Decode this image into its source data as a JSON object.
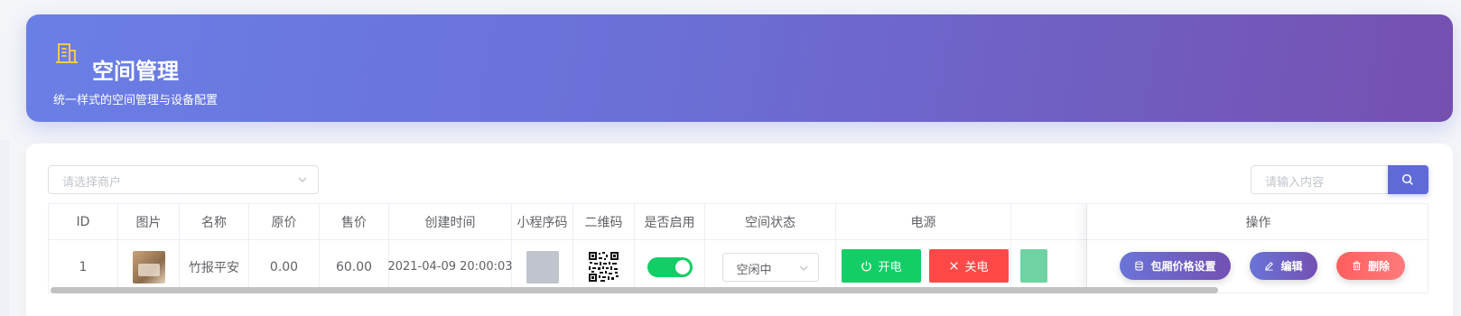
{
  "header": {
    "title": "空间管理",
    "subtitle": "统一样式的空间管理与设备配置",
    "icon": "building-icon"
  },
  "filters": {
    "merchant_placeholder": "请选择商户",
    "search_placeholder": "请输入内容",
    "search_icon": "search-icon"
  },
  "table": {
    "columns": [
      "ID",
      "图片",
      "名称",
      "原价",
      "售价",
      "创建时间",
      "小程序码",
      "二维码",
      "是否启用",
      "空间状态",
      "电源",
      "",
      "操作"
    ],
    "rows": [
      {
        "id": "1",
        "name": "竹报平安",
        "original_price": "0.00",
        "sale_price": "60.00",
        "created_at": "2021-04-09 20:00:03",
        "enabled": true,
        "status": "空闲中",
        "power_on_label": "开电",
        "power_off_label": "关电"
      }
    ],
    "ops_header": "操作",
    "actions": {
      "price_label": "包厢价格设置",
      "edit_label": "编辑",
      "delete_label": "删除"
    }
  },
  "colors": {
    "header_gradient_start": "#6a7fe6",
    "header_gradient_end": "#7550b0",
    "success": "#13ce66",
    "danger": "#ff4949",
    "primary": "#5f6ad8"
  }
}
